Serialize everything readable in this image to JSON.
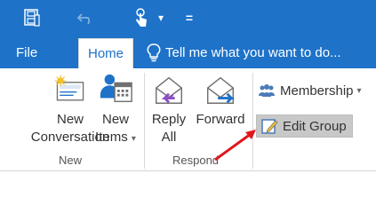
{
  "qat": {
    "save_icon": "save-icon",
    "undo_icon": "undo-icon",
    "touch_icon": "touch-mode-icon",
    "dropdown_glyph": "▾",
    "customize_glyph": "="
  },
  "tabs": {
    "file": "File",
    "home": "Home",
    "tell_me": "Tell me what you want to do..."
  },
  "ribbon": {
    "new_group": {
      "label": "New",
      "new_conversation": [
        "New",
        "Conversation"
      ],
      "new_items": [
        "New",
        "Items"
      ]
    },
    "respond_group": {
      "label": "Respond",
      "reply_all": [
        "Reply",
        "All"
      ],
      "forward": "Forward"
    },
    "group_actions": {
      "membership": "Membership",
      "edit_group": "Edit Group"
    },
    "dropdown_glyph": "▾"
  },
  "colors": {
    "brand_blue": "#1e72c8",
    "annotation_arrow": "#e0161b"
  }
}
